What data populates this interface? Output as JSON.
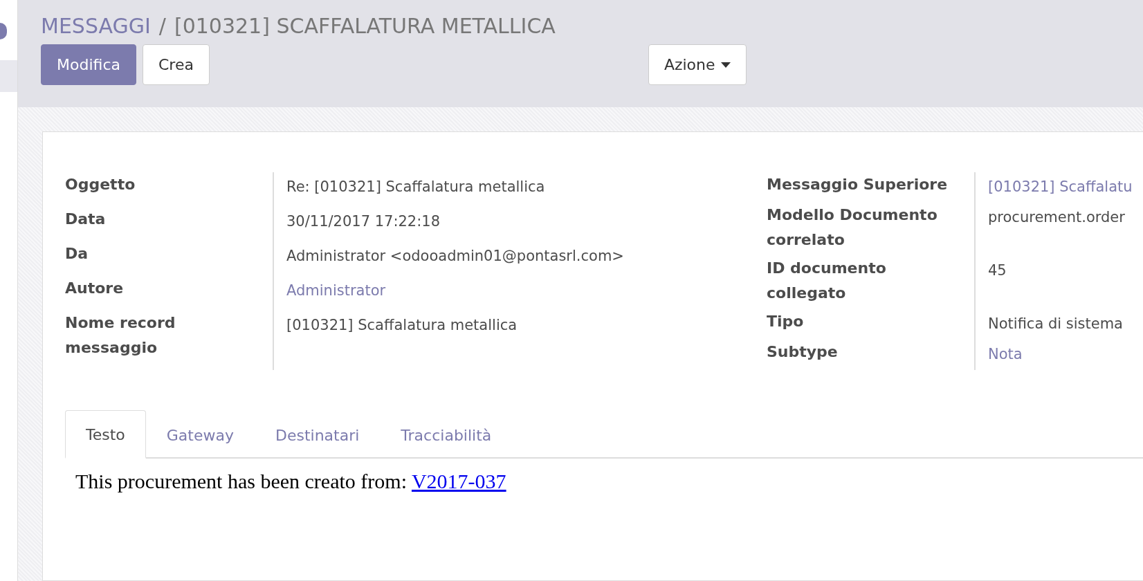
{
  "breadcrumb": {
    "parent": "MESSAGGI",
    "separator": "/",
    "current": "[010321] SCAFFALATURA METALLICA"
  },
  "buttons": [
    {
      "label": "Modifica",
      "kind": "primary"
    },
    {
      "label": "Crea",
      "kind": "secondary"
    }
  ],
  "action_menu": {
    "label": "Azione"
  },
  "fields_left": [
    {
      "label": "Oggetto",
      "value": "Re: [010321] Scaffalatura metallica",
      "kind": "text"
    },
    {
      "label": "Data",
      "value": "30/11/2017 17:22:18",
      "kind": "text"
    },
    {
      "label": "Da",
      "value": "Administrator <odooadmin01@pontasrl.com>",
      "kind": "text"
    },
    {
      "label": "Autore",
      "value": "Administrator",
      "kind": "link"
    },
    {
      "label": "Nome record messaggio",
      "value": "[010321] Scaffalatura metallica",
      "kind": "text"
    }
  ],
  "fields_right": [
    {
      "label": "Messaggio Superiore",
      "value": "[010321] Scaffalatu",
      "kind": "link"
    },
    {
      "label": "Modello Documento correlato",
      "value": "procurement.order",
      "kind": "text"
    },
    {
      "label": "ID documento collegato",
      "value": "45",
      "kind": "text"
    },
    {
      "label": "Tipo",
      "value": "Notifica di sistema",
      "kind": "text"
    },
    {
      "label": "Subtype",
      "value": "Nota",
      "kind": "link"
    }
  ],
  "tabs": [
    {
      "label": "Testo",
      "selected": true
    },
    {
      "label": "Gateway",
      "selected": false
    },
    {
      "label": "Destinatari",
      "selected": false
    },
    {
      "label": "Tracciabilità",
      "selected": false
    }
  ],
  "body": {
    "text": "This procurement has been creato from: ",
    "link": "V2017-037"
  }
}
